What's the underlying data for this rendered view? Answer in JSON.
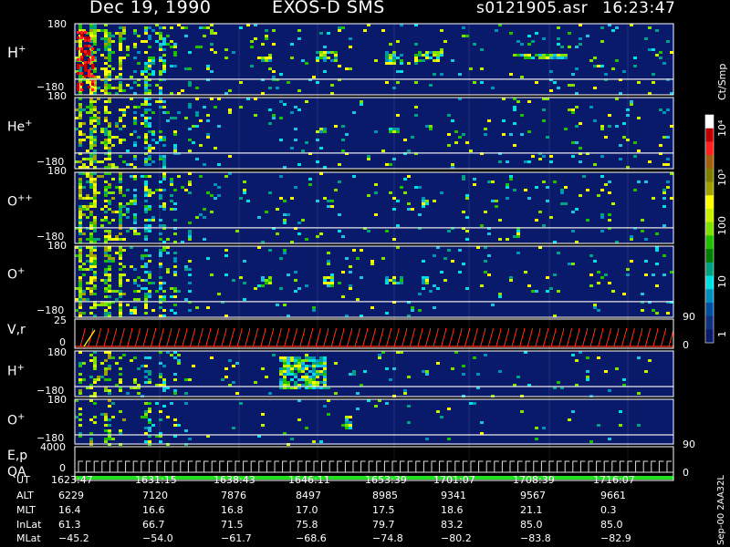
{
  "header": {
    "date": "Dec 19, 1990",
    "instrument": "EXOS-D SMS",
    "file": "s0121905.asr",
    "time": "16:23:47"
  },
  "panels": [
    {
      "label": "H",
      "sup": "+",
      "top": "180",
      "bottom": "−180"
    },
    {
      "label": "He",
      "sup": "+",
      "top": "180",
      "bottom": "−180"
    },
    {
      "label": "O",
      "sup": "++",
      "top": "180",
      "bottom": "−180"
    },
    {
      "label": "O",
      "sup": "+",
      "top": "180",
      "bottom": "−180"
    },
    {
      "label": "V,r",
      "sup": "",
      "top": "25",
      "bottom": "0",
      "right_top": "90",
      "right_bottom": "0"
    },
    {
      "label": "H",
      "sup": "+",
      "top": "180",
      "bottom": "−180"
    },
    {
      "label": "O",
      "sup": "+",
      "top": "180",
      "bottom": "−180"
    },
    {
      "label": "E,p",
      "sup": "",
      "top": "4000",
      "bottom": "0",
      "right_top": "90",
      "right_bottom": "0"
    }
  ],
  "qa_label": "QA",
  "colorbar": {
    "unit": "Ct/Smp",
    "ticks": [
      "10⁴",
      "10³",
      "100",
      "10",
      "1"
    ],
    "colors": [
      "#ffffff",
      "#c00000",
      "#ff2020",
      "#a06010",
      "#808000",
      "#a0a000",
      "#ffff00",
      "#c8f000",
      "#80e000",
      "#20c000",
      "#008000",
      "#00a080",
      "#00e0e0",
      "#0090c0",
      "#0050a0",
      "#103080",
      "#0a1a6a"
    ]
  },
  "side_caption": "Sep-00 2AA32L",
  "orbit_table": {
    "row_labels": [
      "UT",
      "ALT",
      "MLT",
      "InLat",
      "MLat"
    ],
    "columns": [
      [
        "1623:47",
        "6229",
        "16.4",
        "61.3",
        "−45.2"
      ],
      [
        "1631:15",
        "7120",
        "16.6",
        "66.7",
        "−54.0"
      ],
      [
        "1638:43",
        "7876",
        "16.8",
        "71.5",
        "−61.7"
      ],
      [
        "1646:11",
        "8497",
        "17.0",
        "75.8",
        "−68.6"
      ],
      [
        "1653:39",
        "8985",
        "17.5",
        "79.7",
        "−74.8"
      ],
      [
        "1701:07",
        "9341",
        "18.6",
        "83.2",
        "−80.2"
      ],
      [
        "1708:39",
        "9567",
        "21.1",
        "85.0",
        "−83.8"
      ],
      [
        "1716:07",
        "9661",
        "0.3",
        "85.0",
        "−82.9"
      ]
    ]
  },
  "chart_data": {
    "type": "heatmap",
    "title": "Dec 19, 1990   EXOS-D SMS   s0121905.asr  16:23:47",
    "x_tick_labels": [
      "1623:47",
      "1631:15",
      "1638:43",
      "1646:11",
      "1653:39",
      "1701:07",
      "1708:39",
      "1716:07"
    ],
    "colorbar_unit": "Ct/Smp",
    "colorbar_ticks": [
      "1",
      "10",
      "100",
      "10³",
      "10⁴"
    ],
    "panels": [
      {
        "species": "H+",
        "ylim": [
          -180,
          180
        ]
      },
      {
        "species": "He+",
        "ylim": [
          -180,
          180
        ]
      },
      {
        "species": "O++",
        "ylim": [
          -180,
          180
        ]
      },
      {
        "species": "O+",
        "ylim": [
          -180,
          180
        ]
      },
      {
        "species": "V,r",
        "ylim": [
          0,
          25
        ],
        "right_axis": [
          0,
          90
        ]
      },
      {
        "species": "H+",
        "ylim": [
          -180,
          180
        ]
      },
      {
        "species": "O+",
        "ylim": [
          -180,
          180
        ]
      },
      {
        "species": "E,p",
        "ylim": [
          0,
          4000
        ],
        "right_axis": [
          0,
          90
        ]
      }
    ]
  }
}
